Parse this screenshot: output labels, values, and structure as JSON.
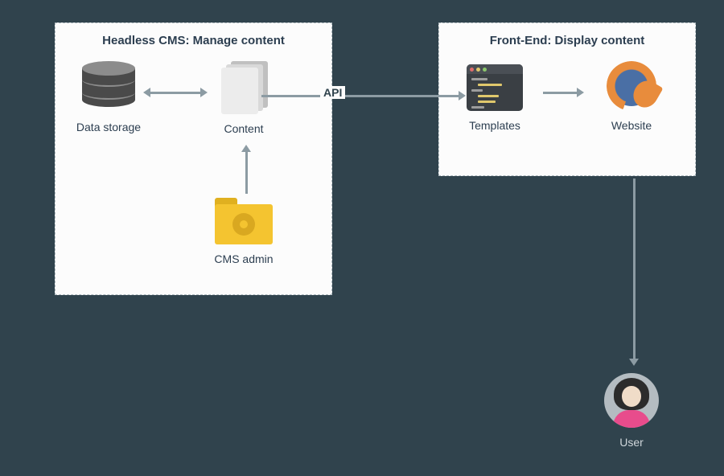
{
  "panels": {
    "cms": {
      "title": "Headless CMS: Manage content"
    },
    "frontend": {
      "title": "Front-End: Display content"
    }
  },
  "nodes": {
    "data_storage": {
      "label": "Data storage"
    },
    "content": {
      "label": "Content"
    },
    "cms_admin": {
      "label": "CMS admin"
    },
    "templates": {
      "label": "Templates"
    },
    "website": {
      "label": "Website"
    },
    "user": {
      "label": "User"
    }
  },
  "connector": {
    "api_label": "API"
  }
}
